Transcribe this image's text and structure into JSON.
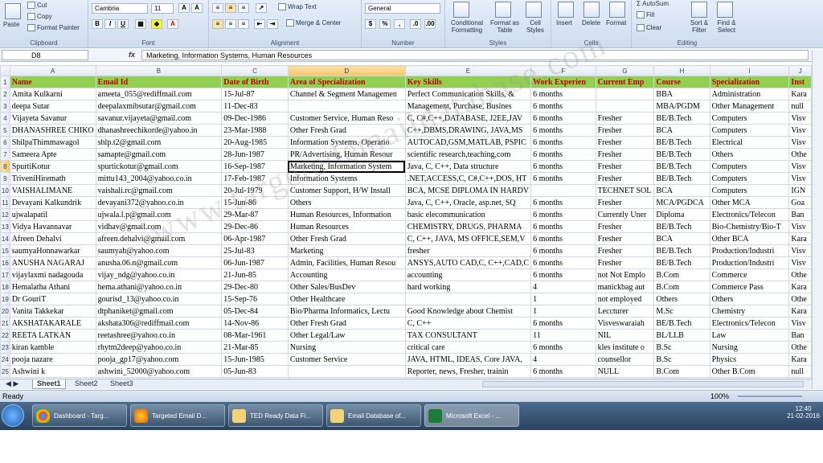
{
  "ribbon": {
    "clipboard": {
      "label": "Clipboard",
      "paste": "Paste",
      "cut": "Cut",
      "copy": "Copy",
      "format_painter": "Format Painter"
    },
    "font": {
      "label": "Font",
      "name": "Cambria",
      "size": "11"
    },
    "alignment": {
      "label": "Alignment",
      "wrap_text": "Wrap Text",
      "merge_center": "Merge & Center"
    },
    "number": {
      "label": "Number",
      "format": "General"
    },
    "styles": {
      "label": "Styles",
      "conditional": "Conditional Formatting",
      "format_table": "Format as Table",
      "cell_styles": "Cell Styles"
    },
    "cells": {
      "label": "Cells",
      "insert": "Insert",
      "delete": "Delete",
      "format": "Format"
    },
    "editing": {
      "label": "Editing",
      "autosum": "AutoSum",
      "fill": "Fill",
      "clear": "Clear",
      "sort_filter": "Sort & Filter",
      "find_select": "Find & Select"
    }
  },
  "formula_bar": {
    "cell_ref": "D8",
    "fx": "fx",
    "content": "Marketing, Information Systems, Human Resources"
  },
  "columns": [
    "A",
    "B",
    "C",
    "D",
    "E",
    "F",
    "G",
    "H",
    "I",
    "J"
  ],
  "header_row": [
    "Name",
    "Email Id",
    "Date of Birth",
    "Area of Specialization",
    "Key Skills",
    "Work Experien",
    "Current Emp",
    "Course",
    "Specialization",
    "Inst"
  ],
  "rows": [
    [
      "Amita Kulkarni",
      "ameeta_055@rediffmail.com",
      "15-Jul-87",
      "Channel & Segment Managemen",
      "Perfect Communication Skills, &",
      "6 months",
      "",
      "BBA",
      "Administration",
      "Kara"
    ],
    [
      "deepa Sutar",
      "deepalaxmibsutar@gmail.com",
      "11-Dec-83",
      "",
      "Management, Purchase, Busines",
      "6 months",
      "",
      "MBA/PGDM",
      "Other Management",
      "null"
    ],
    [
      "Vijayeta Savanur",
      "savanur.vijayeta@gmail.com",
      "09-Dec-1986",
      "Customer Service, Human Reso",
      "C, C#,C++,DATABASE, J2EE,JAV",
      "6 months",
      "Fresher",
      "BE/B.Tech",
      "Computers",
      "Visv"
    ],
    [
      "DHANASHREE CHIKO",
      "dhanashreechikorde@yahoo.in",
      "23-Mar-1988",
      "Other Fresh Grad",
      "C++,DBMS,DRAWING, JAVA,MS",
      "6 months",
      "Fresher",
      "BCA",
      "Computers",
      "Visv"
    ],
    [
      "ShilpaThimmawagol",
      "shlp.t2@gmail.com",
      "20-Aug-1985",
      "Information Systems, Operatio",
      "AUTOCAD,GSM,MATLAB, PSPIC",
      "6 months",
      "Fresher",
      "BE/B.Tech",
      "Electrical",
      "Visv"
    ],
    [
      "Sameera Apte",
      "samapte@gmail.com",
      "28-Jun-1987",
      "PR/Advertising, Human Resour",
      "scientific research,teaching,com",
      "6 months",
      "Fresher",
      "BE/B.Tech",
      "Others",
      "Othe"
    ],
    [
      "SpurtiKotur",
      "spurtickotur@gmail.com",
      "16-Sep-1987",
      "Marketing, Information System",
      "Java, C, C++, Data structure",
      "6 months",
      "Fresher",
      "BE/B.Tech",
      "Computers",
      "Visv"
    ],
    [
      "TriveniHiremath",
      "mittu143_2004@yahoo.co.in",
      "17-Feb-1987",
      "Information Systems",
      ".NET,ACCESS,C, C#,C++,DOS, HT",
      "6 months",
      "Fresher",
      "BE/B.Tech",
      "Computers",
      "Visv"
    ],
    [
      "VAISHALIMANE",
      "vaishali.rc@gmail.com",
      "20-Jul-1979",
      "Customer Support, H/W Install",
      "BCA, MCSE DIPLOMA IN HARDV",
      "",
      "TECHNET SOL",
      "BCA",
      "Computers",
      "IGN"
    ],
    [
      "Devayani Kalkundrik",
      "devayani372@yahoo.co.in",
      "15-Jun-86",
      "Others",
      "Java, C, C++, Oracle, asp.net, SQ",
      "6 months",
      "Fresher",
      "MCA/PGDCA",
      "Other MCA",
      "Goa"
    ],
    [
      "ujwalapatil",
      "ujwala.l.p@gmail.com",
      "29-Mar-87",
      "Human Resources, Information",
      "basic elecommunication",
      "6 months",
      "Currently Uner",
      "Diploma",
      "Electronics/Telecon",
      "Ban"
    ],
    [
      "Vidya Havannavar",
      "vidhav@gmail.com",
      "29-Dec-86",
      "Human Resources",
      "CHEMISTRY, DRUGS, PHARMA",
      "6 months",
      "Fresher",
      "BE/B.Tech",
      "Bio-Chemistry/Bio-T",
      "Visv"
    ],
    [
      "Afreen Dehalvi",
      "afreen.dehalvi@gmail.com",
      "06-Apr-1987",
      "Other Fresh Grad",
      "C, C++, JAVA, MS OFFICE,SEM,V",
      "6 months",
      "Fresher",
      "BCA",
      "Other BCA",
      "Kara"
    ],
    [
      "saumyaHonnawarkar",
      "saumyah@yahoo.com",
      "25-Jul-83",
      "Marketing",
      "fresher",
      "6 months",
      "Fresher",
      "BE/B.Tech",
      "Production/Industri",
      "Visv"
    ],
    [
      "ANUSHA NAGARAJ",
      "anusha.06.n@gmail.com",
      "06-Jun-1987",
      "Admin, Facilities, Human Resou",
      "ANSYS,AUTO CAD,C, C++,CAD,C",
      "6 months",
      "Fresher",
      "BE/B.Tech",
      "Production/Industri",
      "Visv"
    ],
    [
      "vijaylaxmi nadagouda",
      "vijay_ndg@yahoo.co.in",
      "21-Jun-85",
      "Accounting",
      "accounting",
      "6 months",
      "not Not Emplo",
      "B.Com",
      "Commerce",
      "Othe"
    ],
    [
      "Hemalatha Athani",
      "hema.athani@yahoo.co.in",
      "29-Dec-80",
      "Other Sales/BusDev",
      "hard working",
      "4",
      "manickbag aut",
      "B.Com",
      "Commerce Pass",
      "Kara"
    ],
    [
      "Dr GouriT",
      "gourisd_13@yahoo.co.in",
      "15-Sep-76",
      "Other Healthcare",
      "",
      "1",
      "not employed",
      "Others",
      "Others",
      "Othe"
    ],
    [
      "Vanita Takkekar",
      "dtphaniket@gmail.com",
      "05-Dec-84",
      "Bio/Pharma Informatics, Lectu",
      "Good Knowledge about Chemist",
      "1",
      "Leccturer",
      "M.Sc",
      "Chemistry",
      "Kara"
    ],
    [
      "AKSHATAKARALE",
      "akshata306@rediffmail.com",
      "14-Nov-86",
      "Other Fresh Grad",
      "C, C++",
      "6 months",
      "Visveswaraiah",
      "BE/B.Tech",
      "Electronics/Telecon",
      "Visv"
    ],
    [
      "REETA LATKAN",
      "reetashree@yahoo.co.in",
      "08-Mar-1961",
      "Other Legal/Law",
      "TAX CONSULTANT",
      "11",
      "NIL",
      "BL/LLB",
      "Law",
      "Ban"
    ],
    [
      "kiran kamble",
      "rhytm2deep@yahoo.co.in",
      "21-Mar-85",
      "Nursing",
      "critical care",
      "6 months",
      "kles institute o",
      "B.Sc",
      "Nursing",
      "Othe"
    ],
    [
      "pooja nazare",
      "pooja_gp17@yahoo.com",
      "15-Jun-1985",
      "Customer Service",
      "JAVA, HTML, IDEAS, Core JAVA,",
      "4",
      "counsellor",
      "B.Sc",
      "Physics",
      "Kara"
    ],
    [
      "Ashwini k",
      "ashwini_52000@yahoo.com",
      "05-Jun-83",
      "",
      "Reporter, news, Fresher, trainin",
      "6 months",
      "NULL",
      "B.Com",
      "Other B.Com",
      "null"
    ]
  ],
  "selected": {
    "row": 8,
    "col": "D"
  },
  "sheets": [
    "Sheet1",
    "Sheet2",
    "Sheet3"
  ],
  "status": {
    "ready": "Ready",
    "zoom": "100%"
  },
  "taskbar": {
    "items": [
      "Dashboard - Targ...",
      "Targeted Email D...",
      "TED Ready Data Fi...",
      "Email Database of...",
      "Microsoft Excel - ..."
    ],
    "time": "12:40",
    "date": "21-02-2016"
  },
  "watermark": "www.targetedemaildatabase.com",
  "colors": {
    "header_fill": "#92d050",
    "header_text": "#c00000",
    "taskbar": "#2f4a68"
  }
}
